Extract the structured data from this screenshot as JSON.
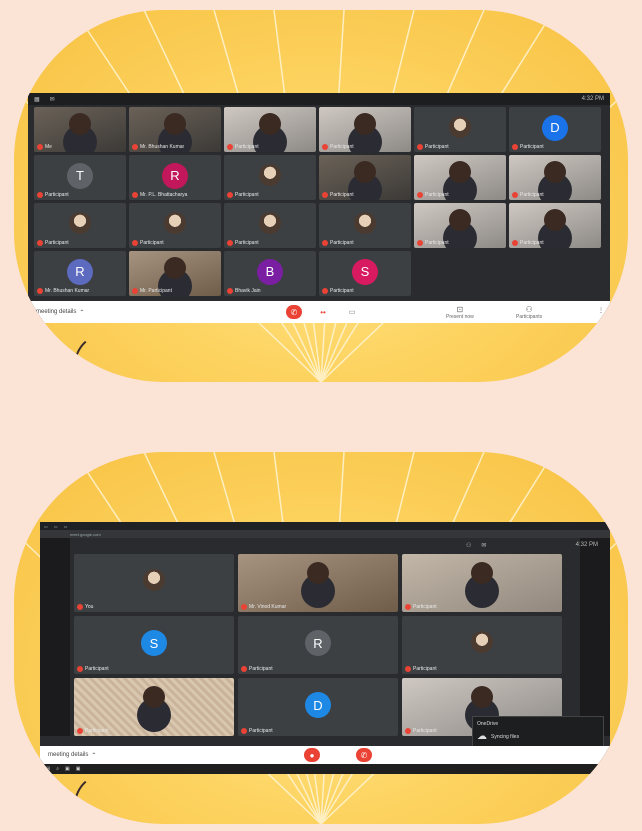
{
  "colors": {
    "page_bg": "#fbe3d6",
    "pill_yellow": "#fdd360",
    "meet_dark": "#2a2b2e",
    "end_call": "#ea4335"
  },
  "screen1": {
    "time": "4:32 PM",
    "footer_left": "meeting details",
    "present_label": "Present now",
    "participants_label": "Participants",
    "tiles": [
      {
        "name": "Me",
        "kind": "video"
      },
      {
        "name": "Mr. Bhushan Kumar",
        "kind": "video"
      },
      {
        "name": "Participant",
        "kind": "video",
        "variant": "light"
      },
      {
        "name": "Participant",
        "kind": "video",
        "variant": "light"
      },
      {
        "name": "Participant",
        "kind": "photo"
      },
      {
        "name": "Participant",
        "kind": "letter",
        "letter": "D",
        "color": "#1a73e8"
      },
      {
        "name": "Participant",
        "kind": "letter",
        "letter": "T",
        "color": "#5f6368"
      },
      {
        "name": "Mr. P.L. Bhattacharya",
        "kind": "letter",
        "letter": "R",
        "color": "#c2185b"
      },
      {
        "name": "Participant",
        "kind": "photo"
      },
      {
        "name": "Participant",
        "kind": "video"
      },
      {
        "name": "Participant",
        "kind": "video",
        "variant": "light"
      },
      {
        "name": "Participant",
        "kind": "video",
        "variant": "light"
      },
      {
        "name": "Participant",
        "kind": "photo"
      },
      {
        "name": "Participant",
        "kind": "photo"
      },
      {
        "name": "Participant",
        "kind": "photo"
      },
      {
        "name": "Participant",
        "kind": "photo"
      },
      {
        "name": "Participant",
        "kind": "video",
        "variant": "light"
      },
      {
        "name": "Participant",
        "kind": "video",
        "variant": "light"
      },
      {
        "name": "Mr. Bhushan Kumar",
        "kind": "letter",
        "letter": "R",
        "color": "#5c6bc0"
      },
      {
        "name": "Mr. Participant",
        "kind": "video",
        "variant": "room"
      },
      {
        "name": "Bhavik Jain",
        "kind": "letter",
        "letter": "B",
        "color": "#7b1fa2"
      },
      {
        "name": "Participant",
        "kind": "letter",
        "letter": "S",
        "color": "#d81b60"
      }
    ]
  },
  "screen2": {
    "time": "4:32 PM",
    "url": "meet.google.com",
    "footer_left": "meeting details",
    "notif_title": "OneDrive",
    "notif_body": "Syncing files",
    "tiles": [
      {
        "name": "You",
        "kind": "photo"
      },
      {
        "name": "Mr. Vinod Kumar",
        "kind": "video",
        "variant": "room"
      },
      {
        "name": "Participant",
        "kind": "video",
        "variant": "wall"
      },
      {
        "name": "Participant",
        "kind": "letter",
        "letter": "S",
        "color": "#1e88e5"
      },
      {
        "name": "Participant",
        "kind": "letter",
        "letter": "R",
        "color": "#5f6368"
      },
      {
        "name": "Participant",
        "kind": "photo"
      },
      {
        "name": "Participant",
        "kind": "video",
        "variant": "pattern"
      },
      {
        "name": "Participant",
        "kind": "letter",
        "letter": "D",
        "color": "#1e88e5"
      },
      {
        "name": "Participant",
        "kind": "video",
        "variant": "light"
      }
    ]
  }
}
